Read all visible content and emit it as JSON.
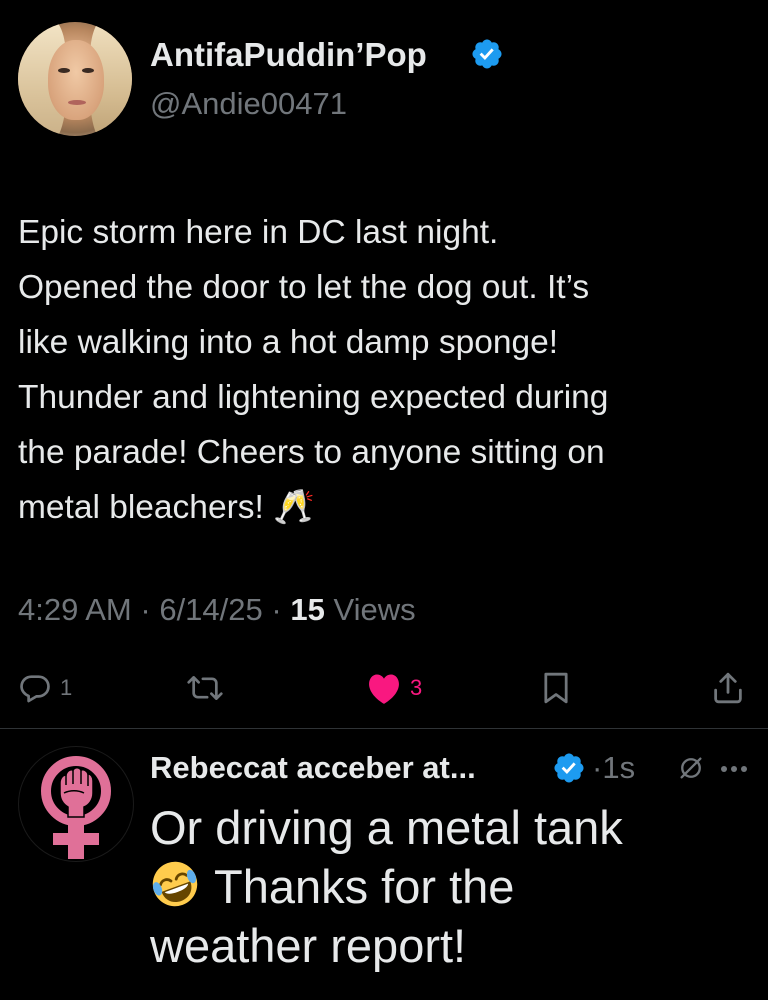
{
  "tweet": {
    "author": {
      "display_name": "AntifaPuddin’Pop",
      "handle": "@Andie00471",
      "verified": true
    },
    "text_lines": [
      "Epic storm here in DC last night.",
      "Opened the door to let the dog out. It’s",
      "like walking into a hot damp sponge!",
      "Thunder and lightening expected during",
      "the parade! Cheers to anyone sitting on",
      "metal bleachers! 🥂"
    ],
    "time": "4:29 AM",
    "date": "6/14/25",
    "separator": "·",
    "views_count": "15",
    "views_label": "Views",
    "actions": {
      "reply_count": "1",
      "retweet_count": "",
      "like_count": "3",
      "liked": true
    }
  },
  "reply": {
    "author": {
      "display_name": "Rebeccat acceber at...",
      "verified": true
    },
    "separator": "·",
    "time": "1s",
    "text_lines": [
      "Or driving a metal tank",
      "Thanks for the",
      "weather report!"
    ],
    "emoji": "rolling-on-floor-laughing"
  },
  "colors": {
    "background": "#000000",
    "text": "#e7e9ea",
    "secondary": "#71767b",
    "verified_blue": "#1d9bf0",
    "like_pink": "#f91880",
    "divider": "#2f3336",
    "feminist_pink": "#e07098"
  },
  "icons": [
    "verified-badge-icon",
    "reply-icon",
    "retweet-icon",
    "heart-icon",
    "bookmark-icon",
    "share-icon",
    "grok-icon",
    "more-icon",
    "champagne-emoji",
    "laughing-emoji"
  ]
}
